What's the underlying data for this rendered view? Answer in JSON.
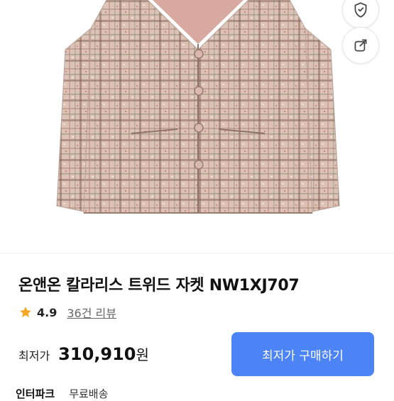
{
  "product": {
    "title": "온앤온 칼라리스 트위드 자켓 NW1XJ707",
    "rating": "4.9",
    "reviews": "36건 리뷰"
  },
  "price": {
    "label": "최저가",
    "value": "310,910",
    "unit": "원"
  },
  "buy_button": {
    "label": "최저가 구매하기"
  },
  "seller": {
    "store": "인터파크",
    "shipping": "무료배송"
  },
  "icons": {
    "wishlist": "heart-shield-icon",
    "share": "share-icon",
    "rating": "star-icon"
  },
  "colors": {
    "accent": "#4c83f5",
    "star": "#f5a623"
  }
}
